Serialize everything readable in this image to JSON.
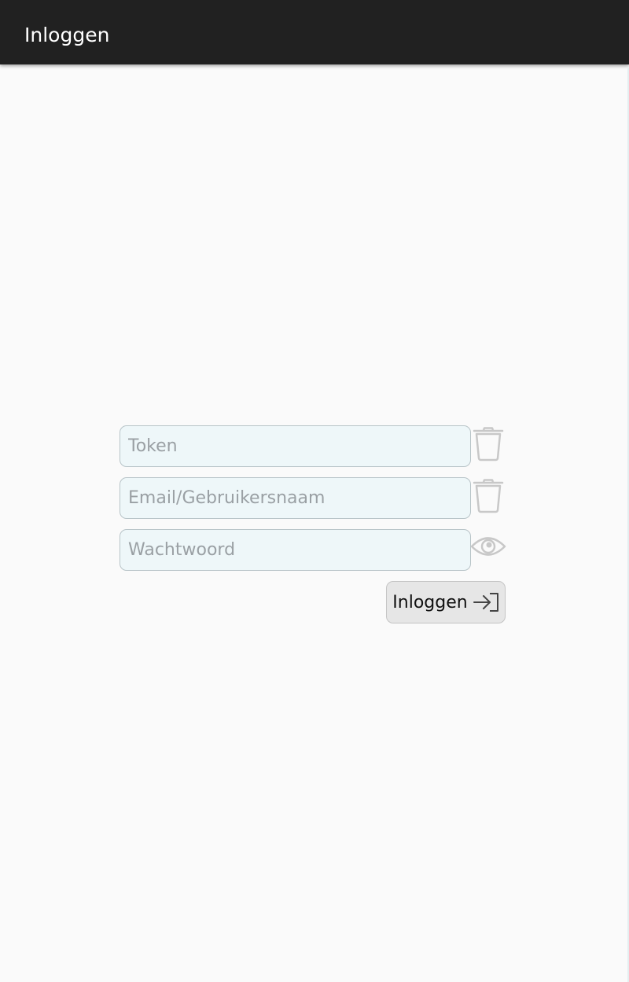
{
  "appbar": {
    "title": "Inloggen"
  },
  "form": {
    "token_placeholder": "Token",
    "username_placeholder": "Email/Gebruikersnaam",
    "password_placeholder": "Wachtwoord",
    "login_label": "Inloggen"
  },
  "icons": {
    "token_clear": "trash-icon",
    "username_clear": "trash-icon",
    "password_toggle": "eye-icon",
    "login": "login-arrow-icon"
  },
  "colors": {
    "appbar": "#212121",
    "field_background": "#eef7f9",
    "icon_gray": "#c8c8c8"
  }
}
